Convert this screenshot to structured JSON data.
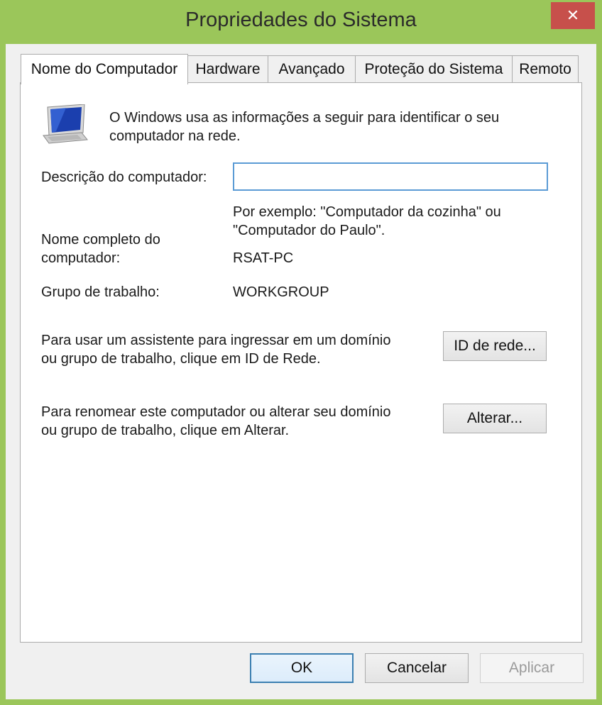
{
  "window": {
    "title": "Propriedades do Sistema",
    "close_glyph": "✕"
  },
  "tabs": [
    {
      "label": "Nome do Computador",
      "active": true
    },
    {
      "label": "Hardware",
      "active": false
    },
    {
      "label": "Avançado",
      "active": false
    },
    {
      "label": "Proteção do Sistema",
      "active": false
    },
    {
      "label": "Remoto",
      "active": false
    }
  ],
  "panel": {
    "icon": "computer-monitor-icon",
    "intro_line1": "O Windows usa as informações a seguir para identificar o seu",
    "intro_line2": "computador na rede.",
    "description_label": "Descrição do computador:",
    "description_value": "",
    "example_line1": "Por exemplo: \"Computador da cozinha\" ou",
    "example_line2": "\"Computador do Paulo\".",
    "full_name_label_line1": "Nome completo do",
    "full_name_label_line2": "computador:",
    "full_name_value": "RSAT-PC",
    "workgroup_label": "Grupo de trabalho:",
    "workgroup_value": "WORKGROUP",
    "network_id_text_line1": "Para usar um assistente para ingressar em um domínio",
    "network_id_text_line2": "ou grupo de trabalho, clique em ID de Rede.",
    "network_id_button": "ID de rede...",
    "rename_text_line1": "Para renomear este computador ou alterar seu domínio",
    "rename_text_line2": "ou grupo de trabalho, clique em Alterar.",
    "rename_button": "Alterar..."
  },
  "footer": {
    "ok": "OK",
    "cancel": "Cancelar",
    "apply": "Aplicar"
  },
  "colors": {
    "frame": "#9bc65a",
    "close": "#c7504b",
    "focus": "#5b9bd5"
  }
}
